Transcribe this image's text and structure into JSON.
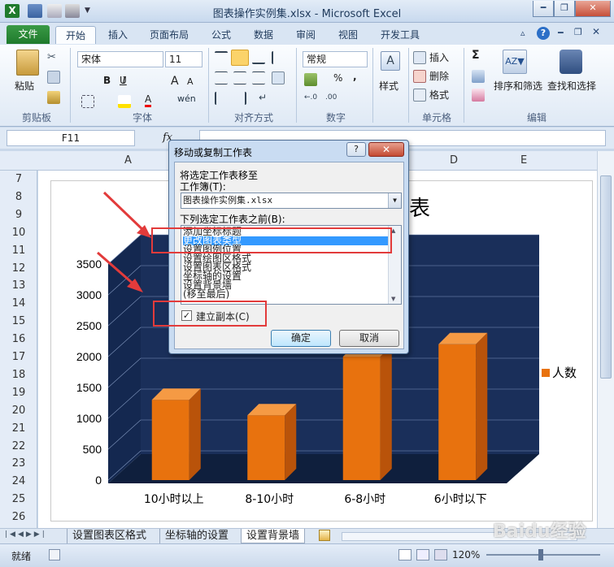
{
  "window": {
    "title": "图表操作实例集.xlsx - Microsoft Excel",
    "app_icon_letter": "X"
  },
  "ribbon": {
    "tabs": [
      {
        "label": "文件"
      },
      {
        "label": "开始"
      },
      {
        "label": "插入"
      },
      {
        "label": "页面布局"
      },
      {
        "label": "公式"
      },
      {
        "label": "数据"
      },
      {
        "label": "审阅"
      },
      {
        "label": "视图"
      },
      {
        "label": "开发工具"
      }
    ],
    "active_tab": "开始",
    "clipboard": {
      "paste_label": "粘贴",
      "group_label": "剪贴板"
    },
    "font": {
      "name": "宋体",
      "size": "11",
      "group_label": "字体",
      "bold": "B",
      "italic": "I",
      "underline": "U",
      "grow": "A",
      "shrink": "A",
      "phonetic": "wén"
    },
    "alignment": {
      "group_label": "对齐方式"
    },
    "number": {
      "format": "常规",
      "group_label": "数字",
      "percent": "%",
      "comma": ","
    },
    "styles": {
      "label": "样式"
    },
    "cells": {
      "insert": "插入",
      "delete": "删除",
      "format": "格式",
      "group_label": "单元格"
    },
    "editing": {
      "sum": "Σ",
      "sort_filter": "排序和筛选",
      "find_select": "查找和选择",
      "group_label": "编辑"
    }
  },
  "formula_bar": {
    "name_box": "F11",
    "fx": "fx",
    "value": ""
  },
  "grid": {
    "columns": [
      "A",
      "B",
      "C",
      "D",
      "E"
    ],
    "rows": [
      "7",
      "8",
      "9",
      "10",
      "11",
      "12",
      "13",
      "14",
      "15",
      "16",
      "17",
      "18",
      "19",
      "20",
      "21",
      "22",
      "23",
      "24",
      "25",
      "26"
    ]
  },
  "chart_data": {
    "type": "bar",
    "title_fragment": "表",
    "categories": [
      "10小时以上",
      "8-10小时",
      "6-8小时",
      "6小时以下"
    ],
    "series": [
      {
        "name": "人数",
        "values": [
          1300,
          1050,
          2000,
          2200
        ],
        "color": "#e8720e"
      }
    ],
    "yticks": [
      0,
      500,
      1000,
      1500,
      2000,
      2500,
      3000,
      3500
    ],
    "ylim": [
      0,
      3500
    ],
    "legend_position": "right",
    "plot_background": "#1a2f5a"
  },
  "dialog": {
    "title": "移动或复制工作表",
    "help": "?",
    "close": "✕",
    "move_label": "将选定工作表移至",
    "workbook_label": "工作簿(T):",
    "workbook_value": "图表操作实例集.xlsx",
    "before_label": "下列选定工作表之前(B):",
    "sheet_list": [
      "添加坐标标题",
      "更改图表类型",
      "设置图例位置",
      "设置绘图区格式",
      "设置图表区格式",
      "坐标轴的设置",
      "设置背景墙",
      "(移至最后)"
    ],
    "selected_index": 1,
    "copy_label": "建立副本(C)",
    "copy_checked": "✓",
    "ok": "确定",
    "cancel": "取消"
  },
  "sheet_tabs": {
    "tabs": [
      "设置图表区格式",
      "坐标轴的设置",
      "设置背景墙"
    ],
    "active": "设置背景墙"
  },
  "status_bar": {
    "ready": "就绪",
    "zoom": "120%"
  },
  "watermark": "Baidu经验"
}
